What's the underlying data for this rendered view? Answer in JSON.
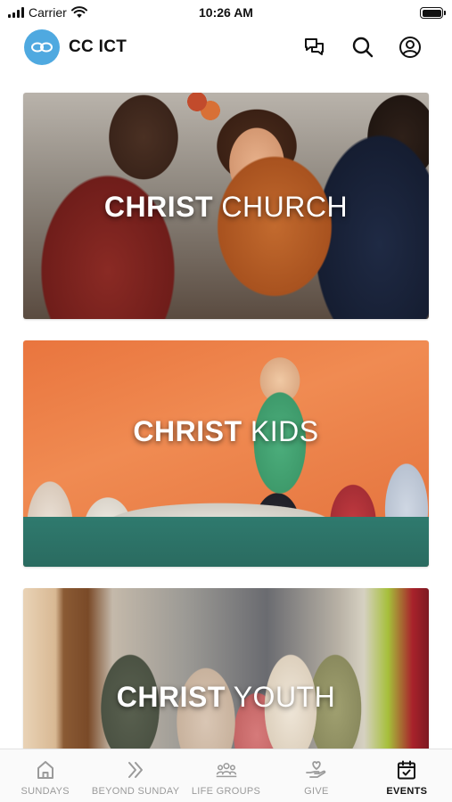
{
  "status_bar": {
    "carrier": "Carrier",
    "time": "10:26 AM"
  },
  "header": {
    "title": "CC ICT",
    "icons": [
      "logo-icon",
      "chat-icon",
      "search-icon",
      "profile-icon"
    ],
    "accent_color": "#4fa9e0"
  },
  "cards": [
    {
      "bold": "CHRIST",
      "light": " CHURCH"
    },
    {
      "bold": "CHRIST",
      "light": " KIDS"
    },
    {
      "bold": "CHRIST",
      "light": " YOUTH"
    }
  ],
  "tabs": [
    {
      "label": "SUNDAYS",
      "icon": "home-icon",
      "active": false
    },
    {
      "label": "BEYOND SUNDAY",
      "icon": "double-chevron-icon",
      "active": false
    },
    {
      "label": "LIFE GROUPS",
      "icon": "group-icon",
      "active": false
    },
    {
      "label": "GIVE",
      "icon": "give-icon",
      "active": false
    },
    {
      "label": "EVENTS",
      "icon": "calendar-icon",
      "active": true
    }
  ]
}
